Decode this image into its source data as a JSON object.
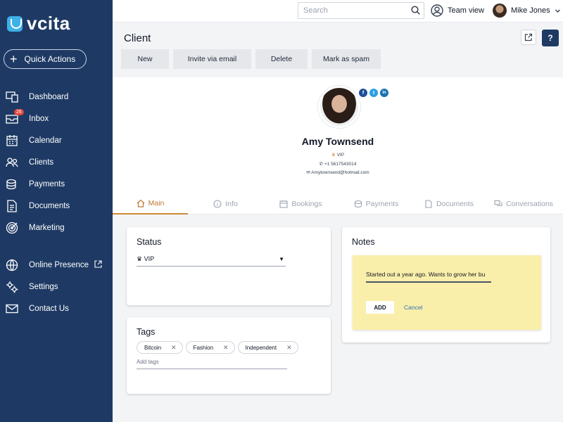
{
  "app": {
    "logo_text": "vcita",
    "brand_color": "#1e3a64",
    "accent_color": "#d08a3b"
  },
  "sidebar": {
    "quick_actions": "Quick Actions",
    "items": [
      {
        "label": "Dashboard",
        "icon": "dashboard-icon"
      },
      {
        "label": "Inbox",
        "icon": "inbox-icon",
        "badge": "26"
      },
      {
        "label": "Calendar",
        "icon": "calendar-icon"
      },
      {
        "label": "Clients",
        "icon": "clients-icon"
      },
      {
        "label": "Payments",
        "icon": "payments-icon"
      },
      {
        "label": "Documents",
        "icon": "documents-icon"
      },
      {
        "label": "Marketing",
        "icon": "marketing-icon"
      }
    ],
    "bottom_items": [
      {
        "label": "Online Presence",
        "icon": "globe-icon"
      },
      {
        "label": "Settings",
        "icon": "settings-icon"
      },
      {
        "label": "Contact Us",
        "icon": "mail-icon"
      }
    ]
  },
  "topbar": {
    "search_placeholder": "Search",
    "team_view": "Team view",
    "user_name": "Mike Jones"
  },
  "client": {
    "title": "Client",
    "actions": [
      "New",
      "Invite via email",
      "Delete",
      "Mark as spam"
    ],
    "name": "Amy Townsend",
    "tier": "VIP",
    "phone": "+1 5617543014",
    "email": "Amytownsend@hotmail.com",
    "social": [
      "f",
      "t",
      "in"
    ]
  },
  "tabs": [
    "Main",
    "Info",
    "Bookings",
    "Payments",
    "Documents",
    "Conversations"
  ],
  "status_card": {
    "title": "Status",
    "value": "VIP"
  },
  "tags_card": {
    "title": "Tags",
    "tags": [
      "Bitcoin",
      "Fashion",
      "Independent"
    ],
    "placeholder": "Add tags"
  },
  "notes_card": {
    "title": "Notes",
    "text": "Started out a year ago. Wants to grow her bu",
    "add_label": "ADD",
    "cancel_label": "Cancel"
  }
}
